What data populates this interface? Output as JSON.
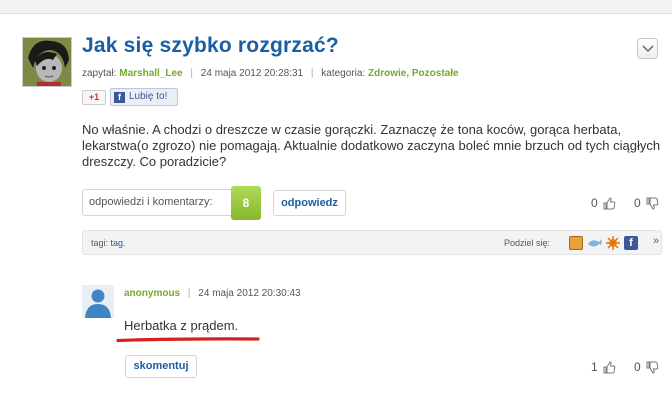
{
  "question": {
    "title": "Jak się szybko rozgrzać?",
    "meta": {
      "asked_label": "zapytał:",
      "user": "Marshall_Lee",
      "date": "24 maja 2012 20:28:31",
      "category_label": "kategoria:",
      "categories": "Zdrowie, Pozostałe"
    },
    "social": {
      "gplus": "+1",
      "fb_like": "Lubię to!"
    },
    "body": "No właśnie. A chodzi o dreszcze w czasie gorączki. Zaznaczę że tona koców, gorąca herbata, lekarstwa(o zgrozo) nie pomagają. Aktualnie dodatkowo zaczyna boleć mnie brzuch od tych ciągłych dreszczy. Co poradzicie?",
    "answers_label": "odpowiedzi i komentarzy:",
    "answers_count": "8",
    "reply_label": "odpowiedz",
    "votes_up": "0",
    "votes_down": "0",
    "tags_label": "tagi:",
    "tag": "tag.",
    "share_label": "Podziel się:",
    "more": "»"
  },
  "comment": {
    "user": "anonymous",
    "date": "24 maja 2012 20:30:43",
    "text": "Herbatka z prądem.",
    "comment_button": "skomentuj",
    "votes_up": "1",
    "votes_down": "0"
  },
  "colors": {
    "link": "#1a5ea3",
    "user": "#78a82c",
    "count_badge": "#9ccb45",
    "annotation": "#d42020"
  },
  "icons": [
    "chevron-down-icon",
    "facebook-icon",
    "thumbs-up-icon",
    "thumbs-down-icon",
    "share-icons",
    "user-placeholder-icon"
  ]
}
